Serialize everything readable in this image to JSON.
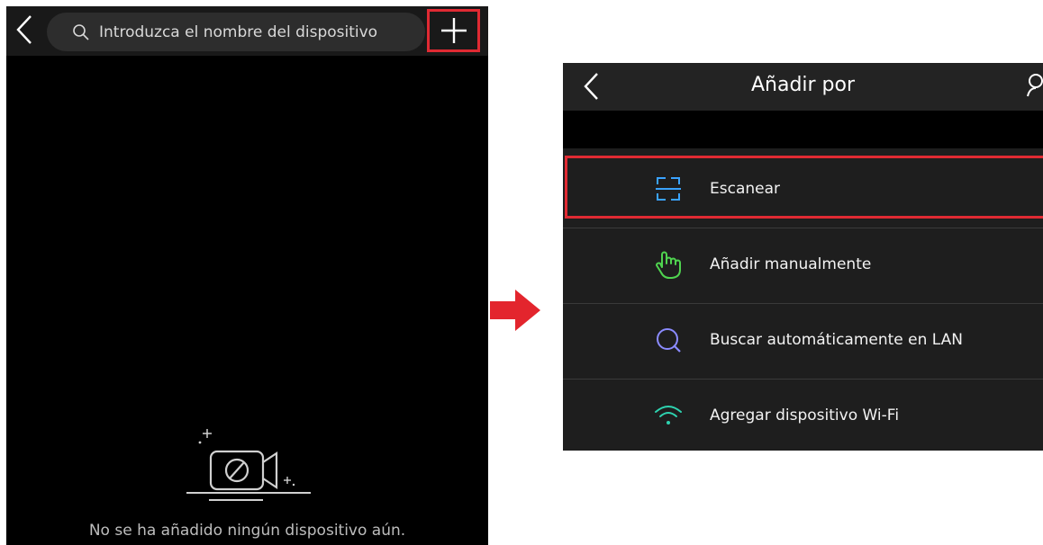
{
  "left_screen": {
    "back_icon": "chevron-left-icon",
    "search": {
      "icon": "search-icon",
      "placeholder": "Introduzca el nombre del dispositivo"
    },
    "add_icon": "plus-icon",
    "empty_state": {
      "illustration": "camera-disabled-icon",
      "message": "No se ha añadido ningún dispositivo aún."
    }
  },
  "transition_arrow": {
    "icon": "arrow-right-icon",
    "color": "#e3252d"
  },
  "right_screen": {
    "back_icon": "chevron-left-icon",
    "title": "Añadir por",
    "corner_icon": "person-icon",
    "menu": [
      {
        "icon": "scan-icon",
        "label": "Escanear",
        "highlighted": true,
        "icon_color": "#3aa3ff"
      },
      {
        "icon": "hand-pointer-icon",
        "label": "Añadir manualmente",
        "icon_color": "#4fd34f"
      },
      {
        "icon": "magnifier-circle-icon",
        "label": "Buscar automáticamente en LAN",
        "icon_color": "#8b8bff"
      },
      {
        "icon": "wifi-icon",
        "label": "Agregar dispositivo Wi-Fi",
        "icon_color": "#2ed3b0"
      }
    ]
  },
  "colors": {
    "highlight_border": "#e02a33",
    "screen_bg": "#000000",
    "panel_bg": "#1e1e1e"
  }
}
